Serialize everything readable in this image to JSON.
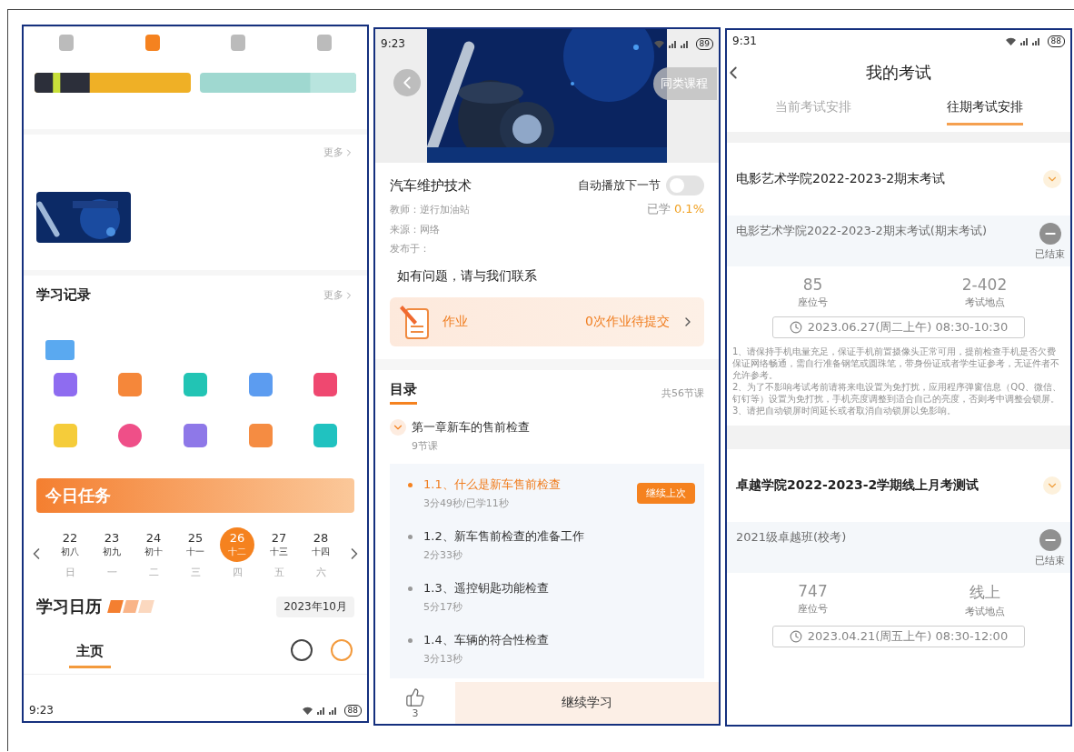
{
  "home_screen": {
    "flipped": true,
    "status_bar": {
      "time": "9:23",
      "battery": "88"
    },
    "header_tabs": [
      {
        "label": "主页",
        "selected": true
      }
    ],
    "calendar": {
      "title": "学习日历",
      "month": "2023年10月",
      "days": [
        {
          "weekday": "日",
          "date": "22",
          "lunar": "初八",
          "selected": false
        },
        {
          "weekday": "一",
          "date": "23",
          "lunar": "初九",
          "selected": false
        },
        {
          "weekday": "二",
          "date": "24",
          "lunar": "初十",
          "selected": false
        },
        {
          "weekday": "三",
          "date": "25",
          "lunar": "十一",
          "selected": false
        },
        {
          "weekday": "四",
          "date": "26",
          "lunar": "十二",
          "selected": true
        },
        {
          "weekday": "五",
          "date": "27",
          "lunar": "十三",
          "selected": false
        },
        {
          "weekday": "六",
          "date": "28",
          "lunar": "十四",
          "selected": false
        }
      ]
    },
    "task_banner": {
      "title": "今日任务"
    },
    "feature_icons": [
      {
        "color": "#8e6cf0"
      },
      {
        "color": "#f5873a"
      },
      {
        "color": "#22c4b4"
      },
      {
        "color": "#5c9cf0"
      },
      {
        "color": "#ef4870"
      },
      {
        "color": "#f5cc3a"
      },
      {
        "color": "#ef4f88"
      },
      {
        "color": "#8e78e8"
      },
      {
        "color": "#f58c42"
      },
      {
        "color": "#20c2c0"
      }
    ],
    "record": {
      "title": "学习记录",
      "more": "更多"
    },
    "recommend": {
      "more": "更多"
    },
    "bottom_nav": [
      {
        "selected": false
      },
      {
        "selected": true
      },
      {
        "selected": false
      },
      {
        "selected": false
      }
    ]
  },
  "course_screen": {
    "status_bar": {
      "time": "9:23",
      "battery": "89"
    },
    "similar_button": "同类课程",
    "title": "汽车维护技术",
    "autoplay": {
      "label": "自动播放下一节",
      "on": false
    },
    "teacher": "教师：逆行加油站",
    "progress": {
      "label": "已学",
      "value": "0.1%"
    },
    "source": "来源：网络",
    "published": "发布于：",
    "notice": "如有问题，请与我们联系",
    "homework": {
      "label": "作业",
      "status": "0次作业待提交"
    },
    "catalog": {
      "title": "目录",
      "count": "共56节课",
      "chapter": {
        "title": "第一章新车的售前检查",
        "count": "9节课",
        "expanded": true,
        "lessons": [
          {
            "title": "1.1、什么是新车售前检查",
            "duration": "3分49秒/已学11秒",
            "selected": true,
            "resume": "继续上次"
          },
          {
            "title": "1.2、新车售前检查的准备工作",
            "duration": "2分33秒",
            "selected": false
          },
          {
            "title": "1.3、遥控钥匙功能检查",
            "duration": "5分17秒",
            "selected": false
          },
          {
            "title": "1.4、车辆的符合性检查",
            "duration": "3分13秒",
            "selected": false
          }
        ]
      }
    },
    "likes": "3",
    "continue_button": "继续学习"
  },
  "exam_screen": {
    "status_bar": {
      "time": "9:31",
      "battery": "88"
    },
    "title": "我的考试",
    "tabs": [
      {
        "label": "当前考试安排",
        "selected": false
      },
      {
        "label": "往期考试安排",
        "selected": true
      }
    ],
    "groups": [
      {
        "title": "电影艺术学院2022-2023-2期末考试",
        "expanded": true,
        "exam": {
          "name": "电影艺术学院2022-2023-2期末考试(期末考试)",
          "status": "已结束",
          "ended": true,
          "seat": "85",
          "seat_label": "座位号",
          "place": "2-402",
          "place_label": "考试地点",
          "time": "2023.06.27(周二上午) 08:30-10:30",
          "notes": "1、请保持手机电量充足，保证手机前置摄像头正常可用，提前检查手机是否欠费保证网络畅通，需自行准备钢笔或圆珠笔，带身份证或者学生证参考，无证件者不允许参考。\n2、为了不影响考试考前请将来电设置为免打扰，应用程序弹窗信息（QQ、微信、钉钉等）设置为免打扰，手机亮度调整到适合自己的亮度，否则考中调整会锁屏。\n3、请把自动锁屏时间延长或者取消自动锁屏以免影响。"
        }
      },
      {
        "title": "卓越学院2022-2023-2学期线上月考测试",
        "expanded": true,
        "exam": {
          "name": "2021级卓越班(校考)",
          "status": "已结束",
          "ended": true,
          "seat": "747",
          "seat_label": "座位号",
          "place": "线上",
          "place_label": "考试地点",
          "time": "2023.04.21(周五上午) 08:30-12:00"
        }
      }
    ]
  }
}
